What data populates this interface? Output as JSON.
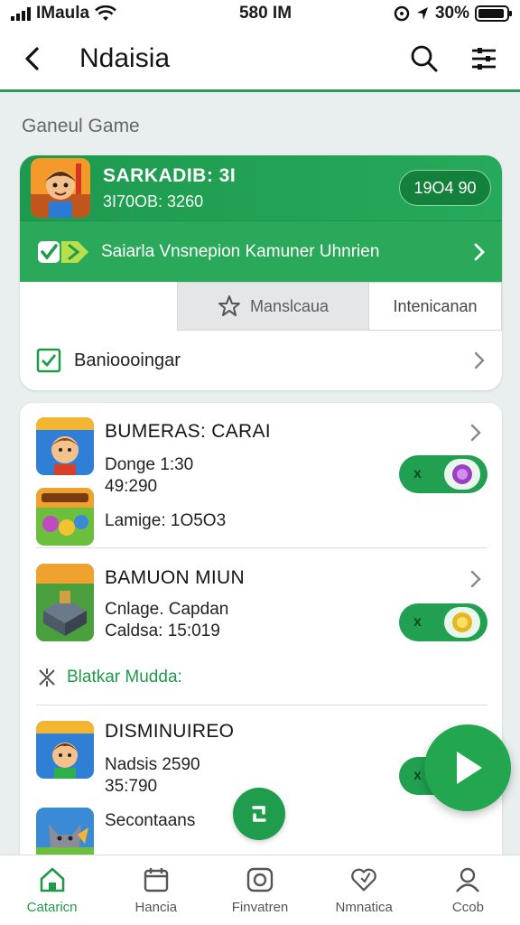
{
  "status_bar": {
    "carrier": "IMaula",
    "time": "580 IM",
    "battery": "30%"
  },
  "header": {
    "title": "Ndaisia",
    "back_icon": "chevron-left-icon",
    "search_icon": "search-icon",
    "menu_icon": "filter-menu-icon"
  },
  "section_title": "Ganeul Game",
  "featured": {
    "name": "SARKADIB: 3I",
    "subtitle": "3I70OB: 3260",
    "price": "19O4 90",
    "banner_text": "Saiarla  Vnsnepion  Kamuner Uhnrien",
    "tabs": [
      {
        "label": "Manslcaua",
        "icon": "star-icon"
      },
      {
        "label": "Intenicanan"
      }
    ],
    "bookmark_label": "Banioooingar"
  },
  "games": [
    {
      "name": "BUMERAS: CARAI",
      "line1": "Donge  1:30",
      "line2": "49:290",
      "line3": "Lamige: 1O5O3"
    },
    {
      "name": "BAMUON MIUN",
      "line1": "Cnlage. Capdan",
      "line2": "Caldsa: 15:019"
    },
    {
      "name": "DISMINUIREO",
      "line1": "Nadsis  2590",
      "line2": "35:790",
      "line3": "Secontaans"
    }
  ],
  "sub_section_label": "Blatkar Mudda:",
  "toggle_symbol": "x",
  "colors": {
    "accent": "#22a64f",
    "accent_dark": "#13803c"
  },
  "bottom_nav": [
    {
      "label": "Cataricn",
      "icon": "home-icon",
      "active": true
    },
    {
      "label": "Hancia",
      "icon": "calendar-icon",
      "active": false
    },
    {
      "label": "Finvatren",
      "icon": "camera-icon",
      "active": false
    },
    {
      "label": "Nmnatica",
      "icon": "heart-icon",
      "active": false
    },
    {
      "label": "Ccob",
      "icon": "profile-icon",
      "active": false
    }
  ]
}
